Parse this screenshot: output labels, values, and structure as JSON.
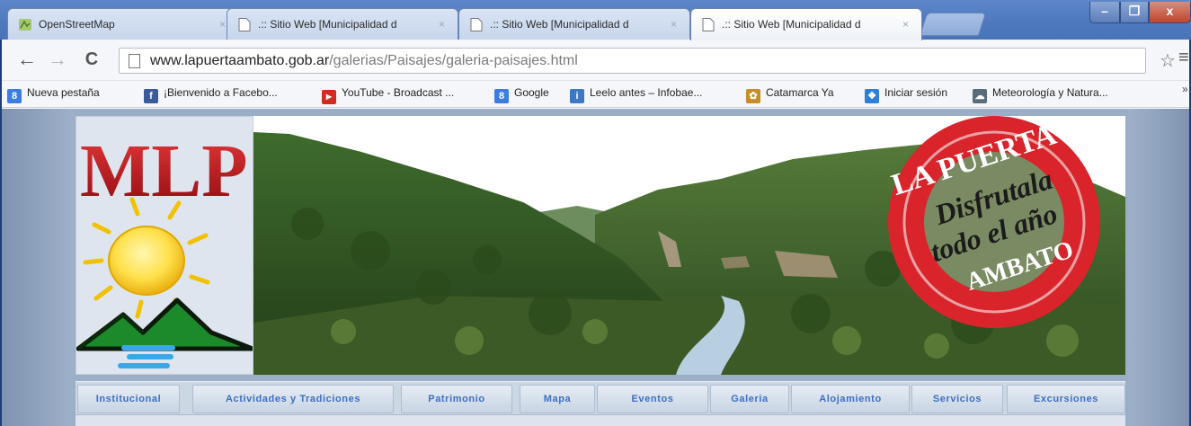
{
  "browser": {
    "tabs": [
      {
        "title": "OpenStreetMap",
        "icon": "openstreetmap-favicon",
        "active": false
      },
      {
        "title": ".:: Sitio Web [Municipalidad d",
        "icon": "page-icon",
        "active": false
      },
      {
        "title": ".:: Sitio Web [Municipalidad d",
        "icon": "page-icon",
        "active": false
      },
      {
        "title": ".:: Sitio Web [Municipalidad d",
        "icon": "page-icon",
        "active": true
      }
    ],
    "tab_close_glyph": "×",
    "window_controls": {
      "minimize": "–",
      "maximize": "❐",
      "close": "x"
    },
    "nav": {
      "back": "←",
      "forward": "→",
      "reload": "C"
    },
    "url_host": "www.lapuertaambato.gob.ar",
    "url_path": "/galerias/Paisajes/galeria-paisajes.html",
    "star_glyph": "☆",
    "menu_glyph": "≡"
  },
  "bookmarks": [
    {
      "label": "Nueva pestaña",
      "icon": "google-icon",
      "color": "#3b7de0",
      "glyph": "8"
    },
    {
      "label": "¡Bienvenido a Facebo...",
      "icon": "facebook-icon",
      "color": "#3b5998",
      "glyph": "f"
    },
    {
      "label": "YouTube - Broadcast ...",
      "icon": "youtube-icon",
      "color": "#d32b20",
      "glyph": "▶"
    },
    {
      "label": "Google",
      "icon": "google-icon",
      "color": "#3b7de0",
      "glyph": "8"
    },
    {
      "label": "Leelo antes – Infobae...",
      "icon": "infobae-icon",
      "color": "#3c78c4",
      "glyph": "i"
    },
    {
      "label": "Catamarca Ya",
      "icon": "catamarca-icon",
      "color": "#c78d2a",
      "glyph": "✿"
    },
    {
      "label": "Iniciar sesión",
      "icon": "windows-live-icon",
      "color": "#2b80d9",
      "glyph": "❖"
    },
    {
      "label": "Meteorología y Natura...",
      "icon": "weather-icon",
      "color": "#5a6b7a",
      "glyph": "☁"
    }
  ],
  "bookmarks_overflow": "»",
  "site": {
    "logo_text": "MLP",
    "stamp": {
      "top": "LA PUERTA",
      "middle1": "Disfrutala",
      "middle2": "todo el año",
      "bottom": "AMBATO"
    },
    "nav_items": [
      "Institucional",
      "Actividades y Tradiciones",
      "Patrimonio",
      "Mapa",
      "Eventos",
      "Galeria",
      "Alojamiento",
      "Servicios",
      "Excursiones"
    ]
  },
  "colors": {
    "logo_red": "#c1121a",
    "nav_text": "#3d6fc2",
    "stamp_red": "#d8242a"
  }
}
